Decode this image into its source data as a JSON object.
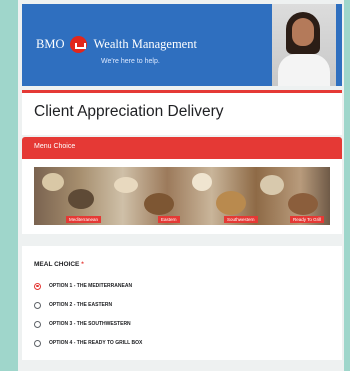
{
  "banner": {
    "brand_left": "BMO",
    "brand_right": "Wealth Management",
    "tagline": "We're here to help."
  },
  "form": {
    "title": "Client Appreciation Delivery",
    "section_label": "Menu Choice",
    "image_tags": [
      "Mediterranean",
      "Eastern",
      "Southwestern",
      "Ready To Grill"
    ]
  },
  "question": {
    "label": "MEAL CHOICE",
    "required_mark": "*",
    "options": [
      {
        "label": "OPTION 1 - THE MEDITERRANEAN",
        "selected": true
      },
      {
        "label": "OPTION 2 - THE EASTERN",
        "selected": false
      },
      {
        "label": "OPTION 3 - THE SOUTHWESTERN",
        "selected": false
      },
      {
        "label": "OPTION 4 - THE READY TO GRILL BOX",
        "selected": false
      }
    ]
  },
  "colors": {
    "accent": "#e53935",
    "banner_blue": "#2f6fbf",
    "background": "#9fd6cb"
  }
}
